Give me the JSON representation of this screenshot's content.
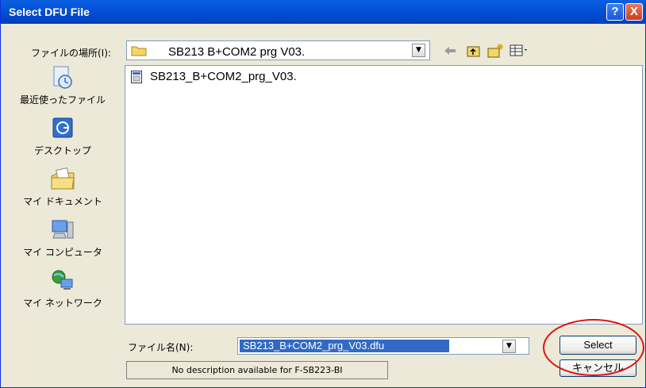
{
  "window": {
    "title": "Select DFU File",
    "help_button": "?",
    "close_button": "X"
  },
  "look_in": {
    "label": "ファイルの場所(I):",
    "value": "SB213 B+COM2 prg V03.",
    "dropdown_arrow": "▼"
  },
  "toolbar": {
    "back_icon": "back-arrow-icon",
    "up_icon": "up-folder-icon",
    "new_folder_icon": "new-folder-icon",
    "view_menu_icon": "view-menu-icon"
  },
  "places": [
    {
      "label": "最近使ったファイル",
      "icon": "recent-files-icon"
    },
    {
      "label": "デスクトップ",
      "icon": "desktop-icon"
    },
    {
      "label": "マイ ドキュメント",
      "icon": "my-documents-icon"
    },
    {
      "label": "マイ コンピュータ",
      "icon": "my-computer-icon"
    },
    {
      "label": "マイ ネットワーク",
      "icon": "my-network-icon"
    }
  ],
  "files": [
    {
      "name": "SB213_B+COM2_prg_V03.",
      "icon": "dfu-file-icon"
    }
  ],
  "file_name": {
    "label": "ファイル名(N):",
    "value": "SB213_B+COM2_prg_V03.dfu",
    "dropdown_arrow": "▼"
  },
  "buttons": {
    "select": "Select",
    "cancel": "キャンセル"
  },
  "description": "No description available for F-SB223-BI",
  "colors": {
    "titlebar": "#0552d8",
    "selection": "#316ac5",
    "annotation": "#e01010"
  }
}
